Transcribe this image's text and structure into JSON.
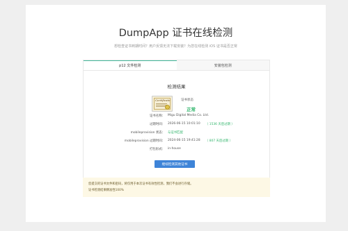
{
  "header": {
    "title": "DumpApp 证书在线检测",
    "subtitle": "想检查证书到期时间？用户反馈无法下载安装？为您在线检测 iOS 证书是否正常"
  },
  "tabs": [
    {
      "label": "p12 文件检测",
      "active": true
    },
    {
      "label": "安装包检测",
      "active": false
    }
  ],
  "result": {
    "title": "检测结果",
    "status_label": "证书状态",
    "status_value": "正常",
    "status_color": "#2fb46a",
    "icon": "certificate-icon",
    "fields": [
      {
        "label": "证书名称：",
        "value": "Migu Digital Media Co. Ltd.",
        "extra": ""
      },
      {
        "label": "过期时间：",
        "value": "2026-06-15 10:01:10",
        "extra": "（ 1536 天后过期 ）"
      },
      {
        "label": "mobileprovision 状态：",
        "value": "",
        "extra": "与证书匹配"
      },
      {
        "label": "mobileprovision 过期时间：",
        "value": "2024-06-15 19:41:28",
        "extra": "（ 807 天后过期 ）"
      },
      {
        "label": "打包形式：",
        "value": "in-house",
        "extra": ""
      }
    ],
    "button_label": "继续检测其他证书"
  },
  "notice": {
    "line1": "您提交的证书文件和密码，将仅用于本次证书有效性检测，我们不会进行存储。",
    "line2": "证书检测结果精准性100%"
  }
}
